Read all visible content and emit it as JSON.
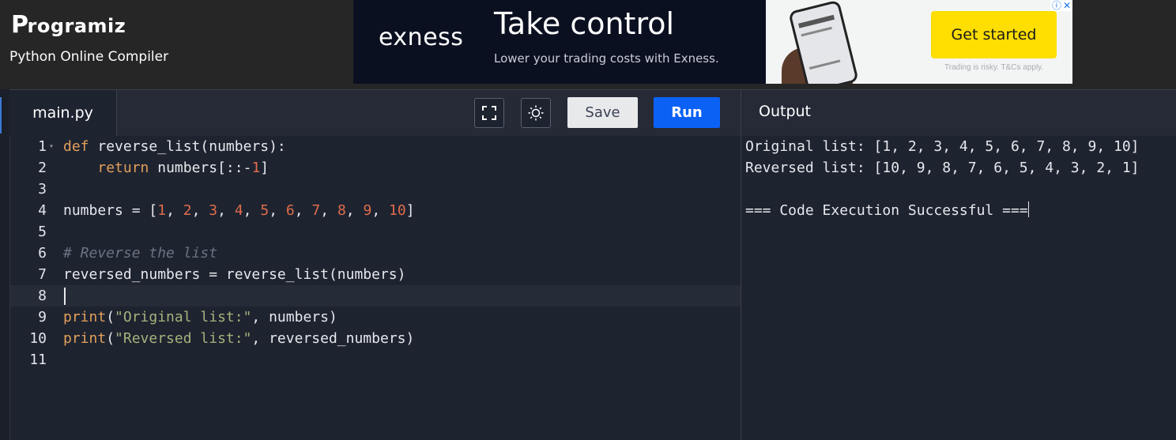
{
  "header": {
    "logo_text": "rogramiz",
    "logo_initial": "P",
    "subtitle": "Python Online Compiler"
  },
  "ad": {
    "brand": "exness",
    "headline": "Take control",
    "tagline": "Lower your trading costs with Exness.",
    "cta": "Get started",
    "disclaimer": "Trading is risky. T&Cs apply.",
    "icons": [
      "info-icon",
      "close-icon"
    ],
    "cta_color": "#ffde02"
  },
  "editor": {
    "tab_label": "main.py",
    "save_label": "Save",
    "run_label": "Run",
    "icons": [
      "fullscreen-icon",
      "theme-toggle-icon"
    ],
    "run_color": "#0c61f5",
    "active_line": 8,
    "line_numbers": [
      "1",
      "2",
      "3",
      "4",
      "5",
      "6",
      "7",
      "8",
      "9",
      "10",
      "11"
    ],
    "lines": [
      [
        {
          "t": "kw",
          "v": "def"
        },
        {
          "t": "",
          "v": " reverse_list(numbers):"
        }
      ],
      [
        {
          "t": "",
          "v": "    "
        },
        {
          "t": "kw",
          "v": "return"
        },
        {
          "t": "",
          "v": " numbers[::-"
        },
        {
          "t": "num",
          "v": "1"
        },
        {
          "t": "",
          "v": "]"
        }
      ],
      [],
      [
        {
          "t": "",
          "v": "numbers = ["
        },
        {
          "t": "num",
          "v": "1"
        },
        {
          "t": "",
          "v": ", "
        },
        {
          "t": "num",
          "v": "2"
        },
        {
          "t": "",
          "v": ", "
        },
        {
          "t": "num",
          "v": "3"
        },
        {
          "t": "",
          "v": ", "
        },
        {
          "t": "num",
          "v": "4"
        },
        {
          "t": "",
          "v": ", "
        },
        {
          "t": "num",
          "v": "5"
        },
        {
          "t": "",
          "v": ", "
        },
        {
          "t": "num",
          "v": "6"
        },
        {
          "t": "",
          "v": ", "
        },
        {
          "t": "num",
          "v": "7"
        },
        {
          "t": "",
          "v": ", "
        },
        {
          "t": "num",
          "v": "8"
        },
        {
          "t": "",
          "v": ", "
        },
        {
          "t": "num",
          "v": "9"
        },
        {
          "t": "",
          "v": ", "
        },
        {
          "t": "num",
          "v": "10"
        },
        {
          "t": "",
          "v": "]"
        }
      ],
      [],
      [
        {
          "t": "cmt",
          "v": "# Reverse the list"
        }
      ],
      [
        {
          "t": "",
          "v": "reversed_numbers = reverse_list(numbers)"
        }
      ],
      [],
      [
        {
          "t": "kw",
          "v": "print"
        },
        {
          "t": "",
          "v": "("
        },
        {
          "t": "str",
          "v": "\"Original list:\""
        },
        {
          "t": "",
          "v": ", numbers)"
        }
      ],
      [
        {
          "t": "kw",
          "v": "print"
        },
        {
          "t": "",
          "v": "("
        },
        {
          "t": "str",
          "v": "\"Reversed list:\""
        },
        {
          "t": "",
          "v": ", reversed_numbers)"
        }
      ],
      []
    ]
  },
  "output": {
    "title": "Output",
    "lines": [
      "Original list: [1, 2, 3, 4, 5, 6, 7, 8, 9, 10]",
      "Reversed list: [10, 9, 8, 7, 6, 5, 4, 3, 2, 1]",
      "",
      "=== Code Execution Successful ==="
    ]
  }
}
